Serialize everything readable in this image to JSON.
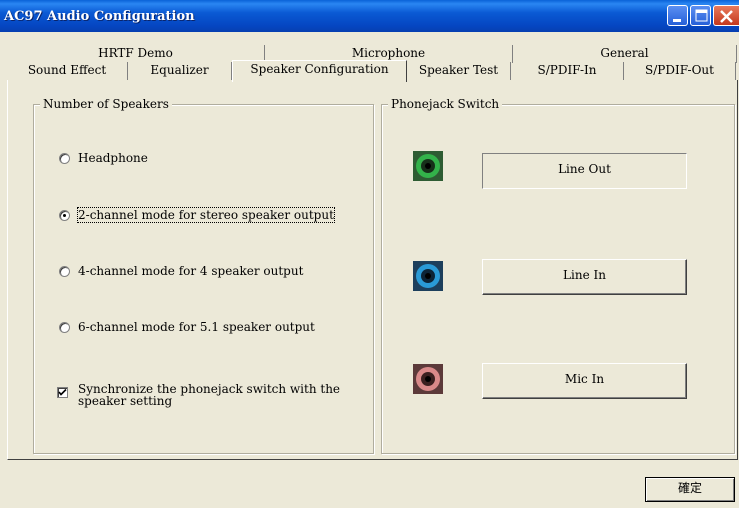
{
  "window": {
    "title": "AC97 Audio Configuration"
  },
  "tabs": {
    "back_row": [
      "HRTF Demo",
      "Microphone",
      "General"
    ],
    "front_row": [
      "Sound Effect",
      "Equalizer",
      "Speaker Configuration",
      "Speaker Test",
      "S/PDIF-In",
      "S/PDIF-Out"
    ],
    "active": "Speaker Configuration"
  },
  "speakers": {
    "legend": "Number of Speakers",
    "options": [
      {
        "label": "Headphone",
        "selected": false
      },
      {
        "label": "2-channel mode for stereo speaker output",
        "selected": true
      },
      {
        "label": "4-channel mode for 4 speaker output",
        "selected": false
      },
      {
        "label": "6-channel mode for 5.1 speaker output",
        "selected": false
      }
    ],
    "sync_checkbox": {
      "label_line1": "Synchronize the phonejack switch with the",
      "label_line2": "speaker setting",
      "checked": true
    }
  },
  "phonejack": {
    "legend": "Phonejack Switch",
    "jacks": [
      {
        "label": "Line Out",
        "color": "#33b24a",
        "icon": "green-jack-icon"
      },
      {
        "label": "Line In",
        "color": "#2a9ad6",
        "icon": "blue-jack-icon"
      },
      {
        "label": "Mic In",
        "color": "#d98a8a",
        "icon": "pink-jack-icon"
      }
    ]
  },
  "footer": {
    "ok_label": "確定"
  }
}
